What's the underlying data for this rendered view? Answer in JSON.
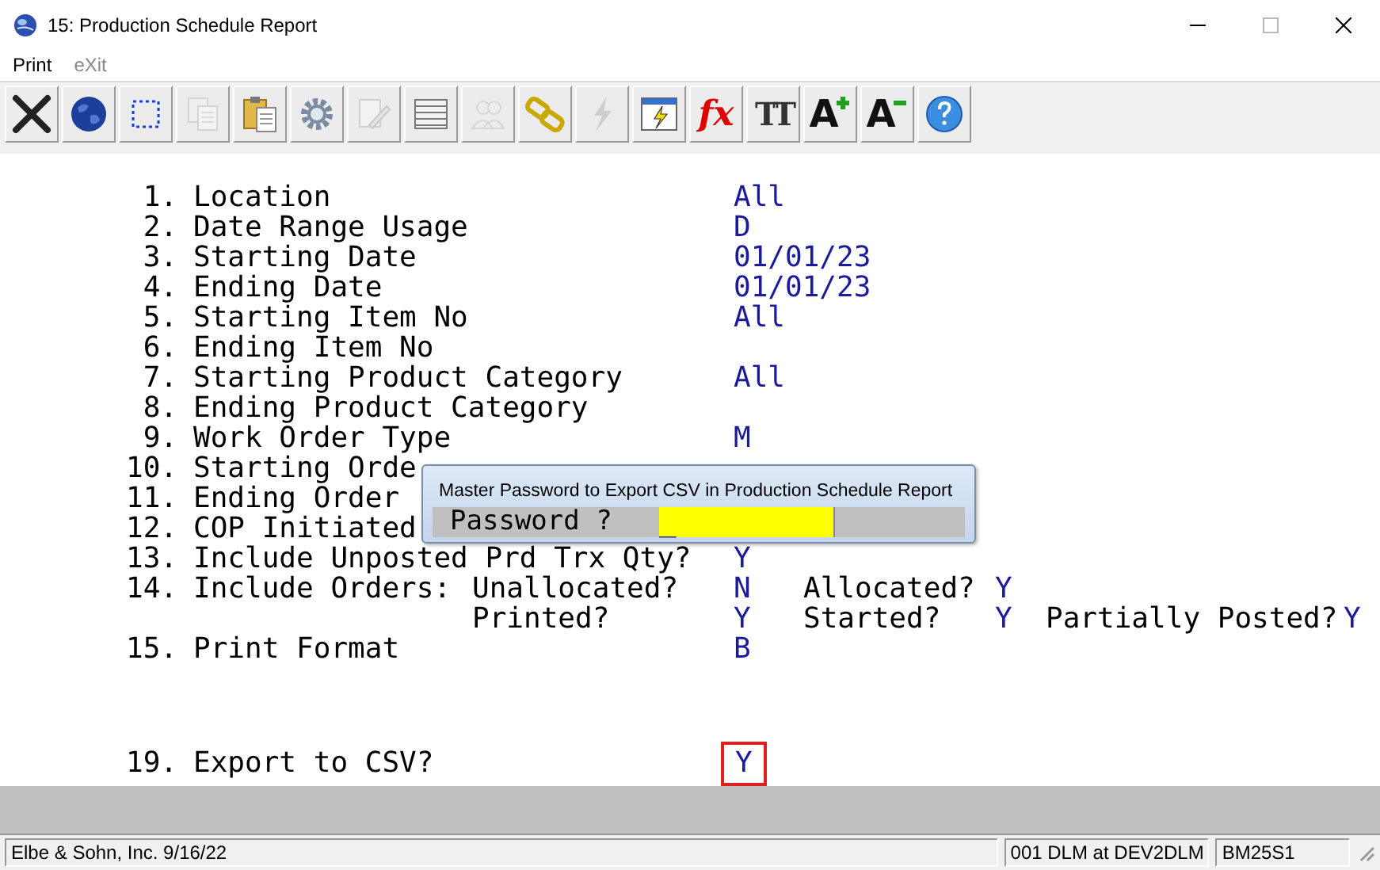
{
  "window": {
    "title": "15: Production Schedule Report"
  },
  "menu": [
    {
      "label": "Print",
      "disabled": false
    },
    {
      "label": "eXit",
      "disabled": true
    }
  ],
  "toolbar": [
    {
      "kind": "close",
      "disabled": false
    },
    {
      "kind": "globe",
      "disabled": false
    },
    {
      "kind": "select",
      "disabled": false
    },
    {
      "kind": "copy",
      "disabled": true
    },
    {
      "kind": "paste",
      "disabled": false
    },
    {
      "kind": "settings",
      "disabled": false
    },
    {
      "kind": "edit",
      "disabled": true
    },
    {
      "kind": "table",
      "disabled": false
    },
    {
      "kind": "users",
      "disabled": true
    },
    {
      "kind": "link",
      "disabled": false
    },
    {
      "kind": "lightning",
      "disabled": true
    },
    {
      "kind": "run",
      "disabled": false
    },
    {
      "kind": "function",
      "glyph": "fx",
      "disabled": false
    },
    {
      "kind": "font",
      "glyph": "TT",
      "disabled": false
    },
    {
      "kind": "font-larger",
      "glyph": "A",
      "disabled": false
    },
    {
      "kind": "font-smaller",
      "glyph": "A",
      "disabled": false
    },
    {
      "kind": "help",
      "disabled": false
    }
  ],
  "rows": [
    {
      "kind": "field",
      "number": "1.",
      "label": "Location",
      "value": "All"
    },
    {
      "kind": "field",
      "number": "2.",
      "label": "Date Range Usage",
      "value": "D"
    },
    {
      "kind": "field",
      "number": "3.",
      "label": "Starting Date",
      "value": "01/01/23"
    },
    {
      "kind": "field",
      "number": "4.",
      "label": "Ending Date",
      "value": "01/01/23"
    },
    {
      "kind": "field",
      "number": "5.",
      "label": "Starting Item No",
      "value": "All"
    },
    {
      "kind": "field",
      "number": "6.",
      "label": "Ending Item No"
    },
    {
      "kind": "field",
      "number": "7.",
      "label": "Starting Product Category",
      "value": "All"
    },
    {
      "kind": "field",
      "number": "8.",
      "label": "Ending Product Category"
    },
    {
      "kind": "field",
      "number": "9.",
      "label": "Work Order Type",
      "value": "M"
    },
    {
      "kind": "field",
      "number": "10.",
      "label": "Starting Orde"
    },
    {
      "kind": "field",
      "number": "11.",
      "label": "Ending Order"
    },
    {
      "kind": "field",
      "number": "12.",
      "label": "COP Initiated"
    },
    {
      "kind": "field",
      "number": "13.",
      "label": "Include Unposted Prd Trx Qty?",
      "value": "Y"
    },
    {
      "kind": "orders",
      "number": "14.",
      "label": "Include Orders:",
      "options": [
        {
          "label": "Unallocated?",
          "value": "N"
        },
        {
          "label": "Allocated?",
          "value": "Y"
        },
        {
          "label": "Printed?",
          "value": "Y"
        },
        {
          "label": "Started?",
          "value": "Y"
        },
        {
          "label": "Partially Posted?",
          "value": "Y"
        }
      ]
    },
    {
      "kind": "field",
      "number": "15.",
      "label": "Print Format",
      "value": "B"
    }
  ],
  "export": {
    "number": "19.",
    "label": "Export to CSV?",
    "value": "Y",
    "highlighted": true
  },
  "dialog": {
    "title": "Master Password to Export CSV in Production Schedule Report",
    "prompt": "Password ?",
    "cursor": "_"
  },
  "status_bar": [
    "Elbe & Sohn, Inc. 9/16/22",
    "001 DLM at DEV2DLM",
    "BM25S1"
  ]
}
